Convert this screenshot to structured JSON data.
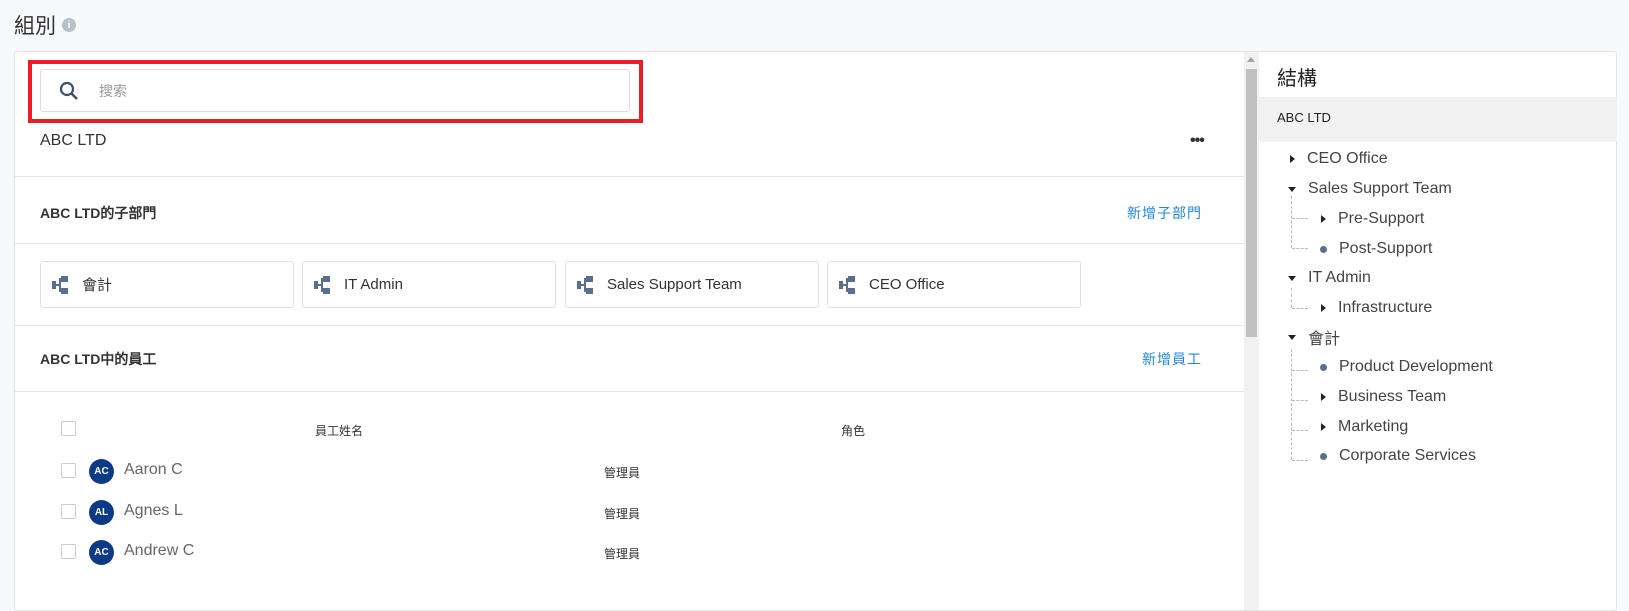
{
  "page": {
    "title": "組別",
    "info_icon": "info-icon"
  },
  "search": {
    "placeholder": "搜索"
  },
  "org": {
    "name": "ABC LTD",
    "more": "•••"
  },
  "subdepartments": {
    "heading": "ABC LTD的子部門",
    "add_label": "新增子部門",
    "items": [
      "會計",
      "IT Admin",
      "Sales Support Team",
      "CEO Office"
    ]
  },
  "employees": {
    "heading": "ABC LTD中的員工",
    "add_label": "新增員工",
    "col_name": "員工姓名",
    "col_role": "角色",
    "rows": [
      {
        "initials": "AC",
        "name": "Aaron C",
        "role": "管理員"
      },
      {
        "initials": "AL",
        "name": "Agnes L",
        "role": "管理員"
      },
      {
        "initials": "AC",
        "name": "Andrew C",
        "role": "管理員"
      }
    ]
  },
  "structure": {
    "title": "結構",
    "root": "ABC LTD",
    "nodes": [
      "CEO Office",
      "Sales Support Team",
      "Pre-Support",
      "Post-Support",
      "IT Admin",
      "Infrastructure",
      "會計",
      "Product Development",
      "Business Team",
      "Marketing",
      "Corporate Services"
    ]
  },
  "colors": {
    "accent": "#1e88e5",
    "avatar": "#0d3a86",
    "highlight": "#ee1c25"
  }
}
